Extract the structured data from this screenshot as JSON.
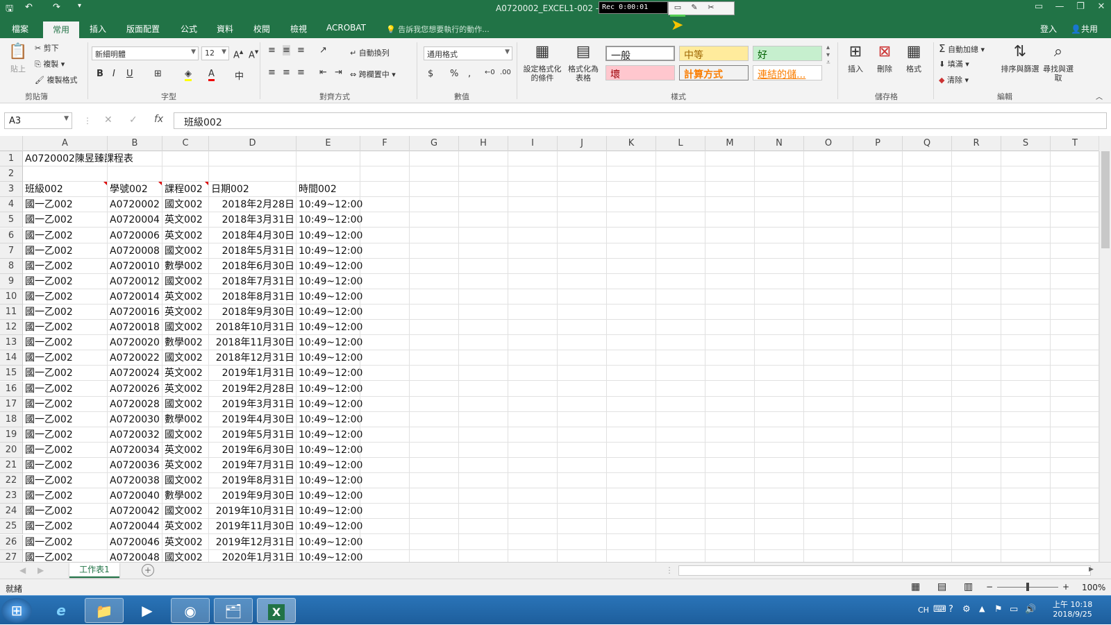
{
  "window": {
    "title": "A0720002_EXCEL1-002 - E",
    "recorder": "Rec 0:00:01"
  },
  "tabs": [
    "檔案",
    "常用",
    "插入",
    "版面配置",
    "公式",
    "資料",
    "校閱",
    "檢視",
    "ACROBAT"
  ],
  "tellme": "告訴我您想要執行的動作...",
  "account": {
    "signin": "登入",
    "share": "共用"
  },
  "ribbon": {
    "clipboard": {
      "paste": "貼上",
      "cut": "剪下",
      "copy": "複製",
      "format_painter": "複製格式",
      "group": "剪貼簿"
    },
    "font": {
      "name": "新細明體",
      "size": "12",
      "group": "字型",
      "bold": "B",
      "italic": "I",
      "underline": "U"
    },
    "alignment": {
      "wrap": "自動換列",
      "merge": "跨欄置中",
      "group": "對齊方式"
    },
    "number": {
      "format": "通用格式",
      "group": "數值",
      "currency": "$",
      "percent": "%",
      "comma": ","
    },
    "styles": {
      "conditional": "設定格式化的條件",
      "as_table": "格式化為表格",
      "normal": "一般",
      "neutral": "中等",
      "good": "好",
      "bad": "壞",
      "calc": "計算方式",
      "link": "連結的儲...",
      "group": "樣式"
    },
    "cells": {
      "insert": "插入",
      "delete": "刪除",
      "format": "格式",
      "group": "儲存格"
    },
    "editing": {
      "autosum": "自動加總",
      "fill": "填滿",
      "clear": "清除",
      "sort": "排序與篩選",
      "find": "尋找與選取",
      "group": "編輯"
    }
  },
  "formula_bar": {
    "name_box": "A3",
    "formula": "班級002"
  },
  "columns": [
    "A",
    "B",
    "C",
    "D",
    "E",
    "F",
    "G",
    "H",
    "I",
    "J",
    "K",
    "L",
    "M",
    "N",
    "O",
    "P",
    "Q",
    "R",
    "S",
    "T"
  ],
  "rows": [
    {
      "n": "1",
      "a": "A0720002陳昱臻課程表",
      "b": "",
      "c": "",
      "d": "",
      "e": ""
    },
    {
      "n": "2",
      "a": "",
      "b": "",
      "c": "",
      "d": "",
      "e": ""
    },
    {
      "n": "3",
      "a": "班級002",
      "b": "學號002",
      "c": "課程002",
      "d": "日期002",
      "e": "時間002"
    },
    {
      "n": "4",
      "a": "國一乙002",
      "b": "A0720002",
      "c": "國文002",
      "d": "2018年2月28日",
      "e": "10:49~12:00"
    },
    {
      "n": "5",
      "a": "國一乙002",
      "b": "A0720004",
      "c": "英文002",
      "d": "2018年3月31日",
      "e": "10:49~12:00"
    },
    {
      "n": "6",
      "a": "國一乙002",
      "b": "A0720006",
      "c": "英文002",
      "d": "2018年4月30日",
      "e": "10:49~12:00"
    },
    {
      "n": "7",
      "a": "國一乙002",
      "b": "A0720008",
      "c": "國文002",
      "d": "2018年5月31日",
      "e": "10:49~12:00"
    },
    {
      "n": "8",
      "a": "國一乙002",
      "b": "A0720010",
      "c": "數學002",
      "d": "2018年6月30日",
      "e": "10:49~12:00"
    },
    {
      "n": "9",
      "a": "國一乙002",
      "b": "A0720012",
      "c": "國文002",
      "d": "2018年7月31日",
      "e": "10:49~12:00"
    },
    {
      "n": "10",
      "a": "國一乙002",
      "b": "A0720014",
      "c": "英文002",
      "d": "2018年8月31日",
      "e": "10:49~12:00"
    },
    {
      "n": "11",
      "a": "國一乙002",
      "b": "A0720016",
      "c": "英文002",
      "d": "2018年9月30日",
      "e": "10:49~12:00"
    },
    {
      "n": "12",
      "a": "國一乙002",
      "b": "A0720018",
      "c": "國文002",
      "d": "2018年10月31日",
      "e": "10:49~12:00"
    },
    {
      "n": "13",
      "a": "國一乙002",
      "b": "A0720020",
      "c": "數學002",
      "d": "2018年11月30日",
      "e": "10:49~12:00"
    },
    {
      "n": "14",
      "a": "國一乙002",
      "b": "A0720022",
      "c": "國文002",
      "d": "2018年12月31日",
      "e": "10:49~12:00"
    },
    {
      "n": "15",
      "a": "國一乙002",
      "b": "A0720024",
      "c": "英文002",
      "d": "2019年1月31日",
      "e": "10:49~12:00"
    },
    {
      "n": "16",
      "a": "國一乙002",
      "b": "A0720026",
      "c": "英文002",
      "d": "2019年2月28日",
      "e": "10:49~12:00"
    },
    {
      "n": "17",
      "a": "國一乙002",
      "b": "A0720028",
      "c": "國文002",
      "d": "2019年3月31日",
      "e": "10:49~12:00"
    },
    {
      "n": "18",
      "a": "國一乙002",
      "b": "A0720030",
      "c": "數學002",
      "d": "2019年4月30日",
      "e": "10:49~12:00"
    },
    {
      "n": "19",
      "a": "國一乙002",
      "b": "A0720032",
      "c": "國文002",
      "d": "2019年5月31日",
      "e": "10:49~12:00"
    },
    {
      "n": "20",
      "a": "國一乙002",
      "b": "A0720034",
      "c": "英文002",
      "d": "2019年6月30日",
      "e": "10:49~12:00"
    },
    {
      "n": "21",
      "a": "國一乙002",
      "b": "A0720036",
      "c": "英文002",
      "d": "2019年7月31日",
      "e": "10:49~12:00"
    },
    {
      "n": "22",
      "a": "國一乙002",
      "b": "A0720038",
      "c": "國文002",
      "d": "2019年8月31日",
      "e": "10:49~12:00"
    },
    {
      "n": "23",
      "a": "國一乙002",
      "b": "A0720040",
      "c": "數學002",
      "d": "2019年9月30日",
      "e": "10:49~12:00"
    },
    {
      "n": "24",
      "a": "國一乙002",
      "b": "A0720042",
      "c": "國文002",
      "d": "2019年10月31日",
      "e": "10:49~12:00"
    },
    {
      "n": "25",
      "a": "國一乙002",
      "b": "A0720044",
      "c": "英文002",
      "d": "2019年11月30日",
      "e": "10:49~12:00"
    },
    {
      "n": "26",
      "a": "國一乙002",
      "b": "A0720046",
      "c": "英文002",
      "d": "2019年12月31日",
      "e": "10:49~12:00"
    },
    {
      "n": "27",
      "a": "國一乙002",
      "b": "A0720048",
      "c": "國文002",
      "d": "2020年1月31日",
      "e": "10:49~12:00"
    }
  ],
  "sheet_tab": "工作表1",
  "status": {
    "mode": "就緒",
    "zoom": "100%"
  },
  "taskbar": {
    "ime": "CH",
    "time": "上午 10:18",
    "date": "2018/9/25"
  },
  "colors": {
    "accent": "#217346",
    "taskbar": "#1d5e9c"
  }
}
